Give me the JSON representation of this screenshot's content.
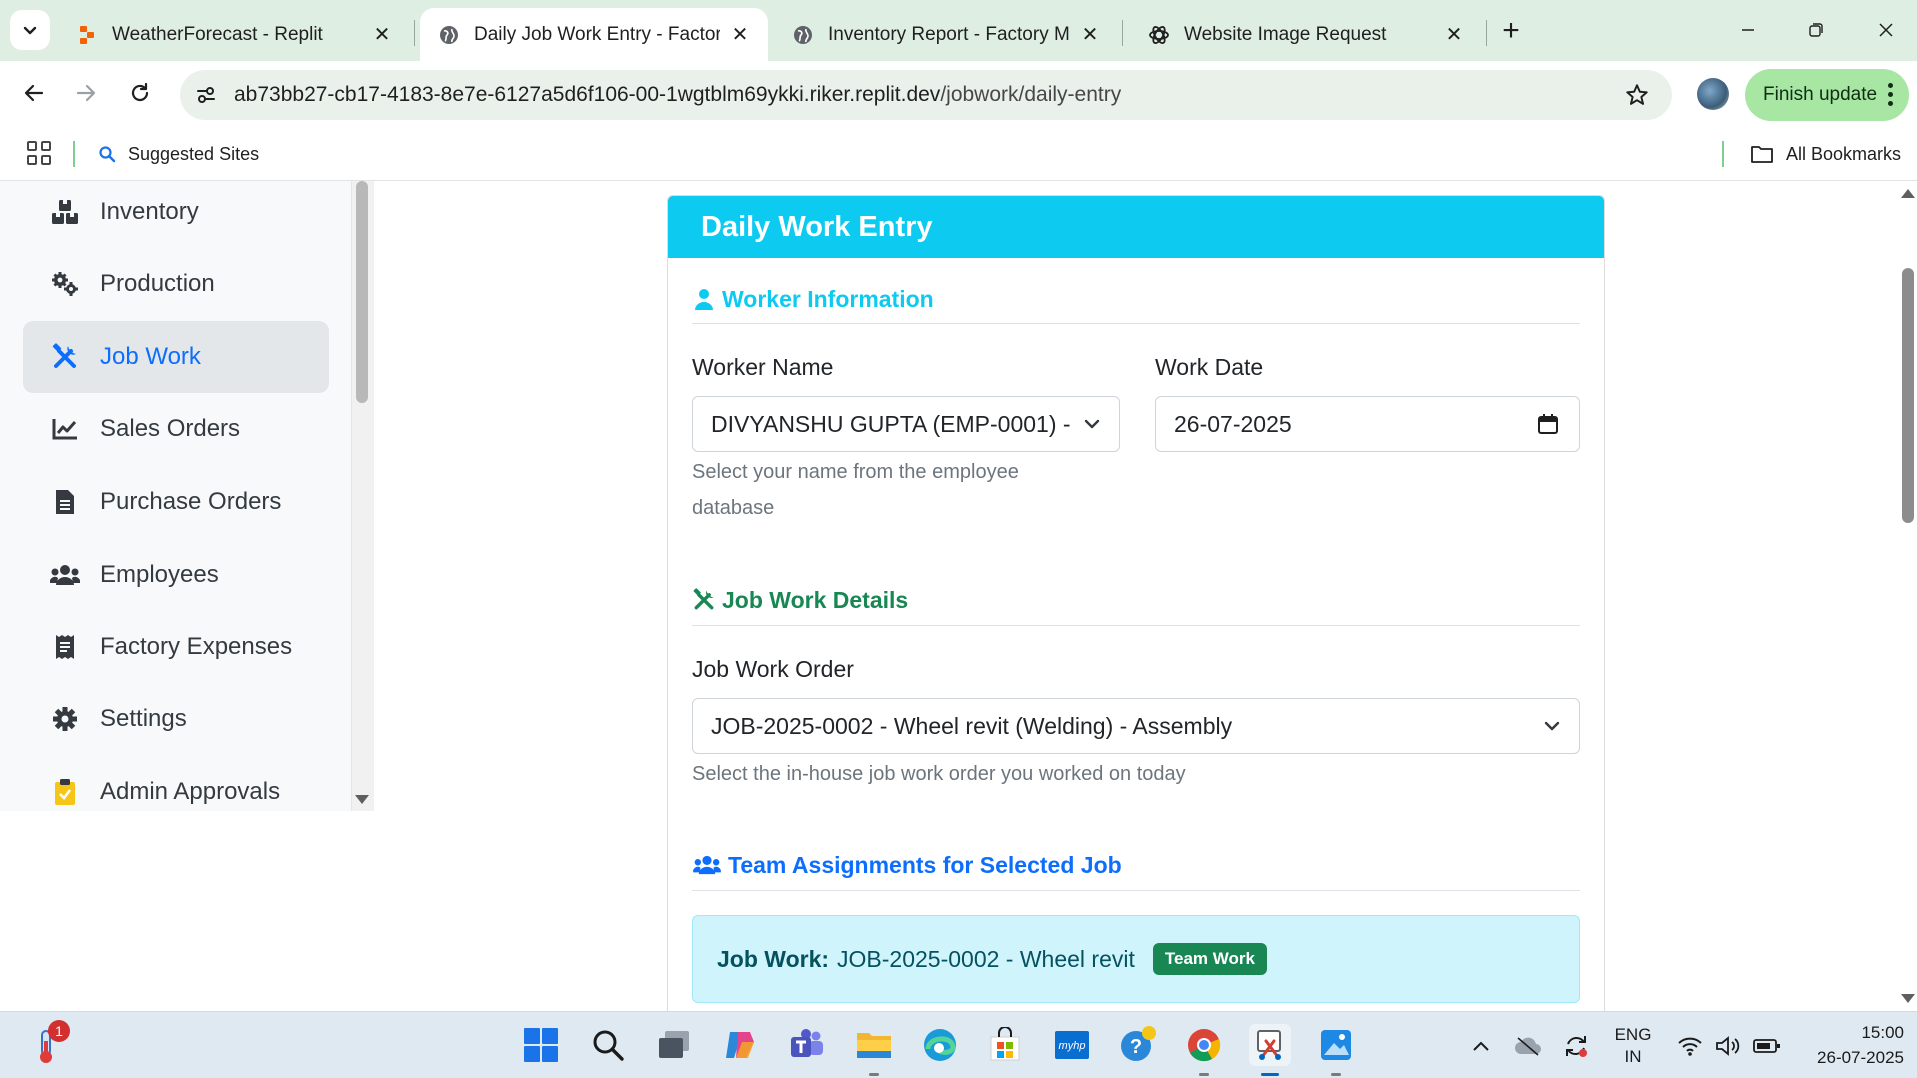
{
  "browser": {
    "tabs": [
      {
        "title": "WeatherForecast - Replit",
        "favicon": "replit-icon",
        "active": false
      },
      {
        "title": "Daily Job Work Entry - Factory M",
        "favicon": "globe-icon",
        "active": true
      },
      {
        "title": "Inventory Report - Factory Man",
        "favicon": "globe-icon",
        "active": false
      },
      {
        "title": "Website Image Request",
        "favicon": "openai-icon",
        "active": false
      }
    ],
    "url_host": "ab73bb27-cb17-4183-8e7e-6127a5d6f106-00-1wgtblm69ykki.riker.replit.dev",
    "url_path": "/jobwork/daily-entry",
    "finish_update_label": "Finish update",
    "bookmarks": {
      "suggested_sites": "Suggested Sites",
      "all_bookmarks": "All Bookmarks"
    }
  },
  "sidebar": {
    "items": [
      {
        "label": "Inventory",
        "icon": "boxes-icon",
        "active": false
      },
      {
        "label": "Production",
        "icon": "gears-icon",
        "active": false
      },
      {
        "label": "Job Work",
        "icon": "tools-icon",
        "active": true
      },
      {
        "label": "Sales Orders",
        "icon": "chart-line-icon",
        "active": false
      },
      {
        "label": "Purchase Orders",
        "icon": "document-icon",
        "active": false
      },
      {
        "label": "Employees",
        "icon": "users-icon",
        "active": false
      },
      {
        "label": "Factory Expenses",
        "icon": "receipt-icon",
        "active": false
      },
      {
        "label": "Settings",
        "icon": "gear-icon",
        "active": false
      },
      {
        "label": "Admin Approvals",
        "icon": "clipboard-check-icon",
        "active": false
      }
    ]
  },
  "form": {
    "header": "Daily Work Entry",
    "worker_section": {
      "title": "Worker Information",
      "worker_name_label": "Worker Name",
      "worker_name_value": "DIVYANSHU GUPTA (EMP-0001) -",
      "worker_name_help": "Select your name from the employee database",
      "work_date_label": "Work Date",
      "work_date_value": "26-07-2025"
    },
    "job_section": {
      "title": "Job Work Details",
      "order_label": "Job Work Order",
      "order_value": "JOB-2025-0002 - Wheel revit (Welding) - Assembly",
      "order_help": "Select the in-house job work order you worked on today"
    },
    "team_section": {
      "title": "Team Assignments for Selected Job",
      "job_work_label": "Job Work:",
      "job_work_value": "JOB-2025-0002 - Wheel revit",
      "badge": "Team Work"
    }
  },
  "colors": {
    "header_bg": "#0dcaf0",
    "primary": "#0d6efd",
    "success": "#198754",
    "info_bg": "#cff4fc",
    "finish_update_bg": "#a8e6a4"
  },
  "taskbar": {
    "notification_count": "1",
    "language_line1": "ENG",
    "language_line2": "IN",
    "time": "15:00",
    "date": "26-07-2025"
  }
}
